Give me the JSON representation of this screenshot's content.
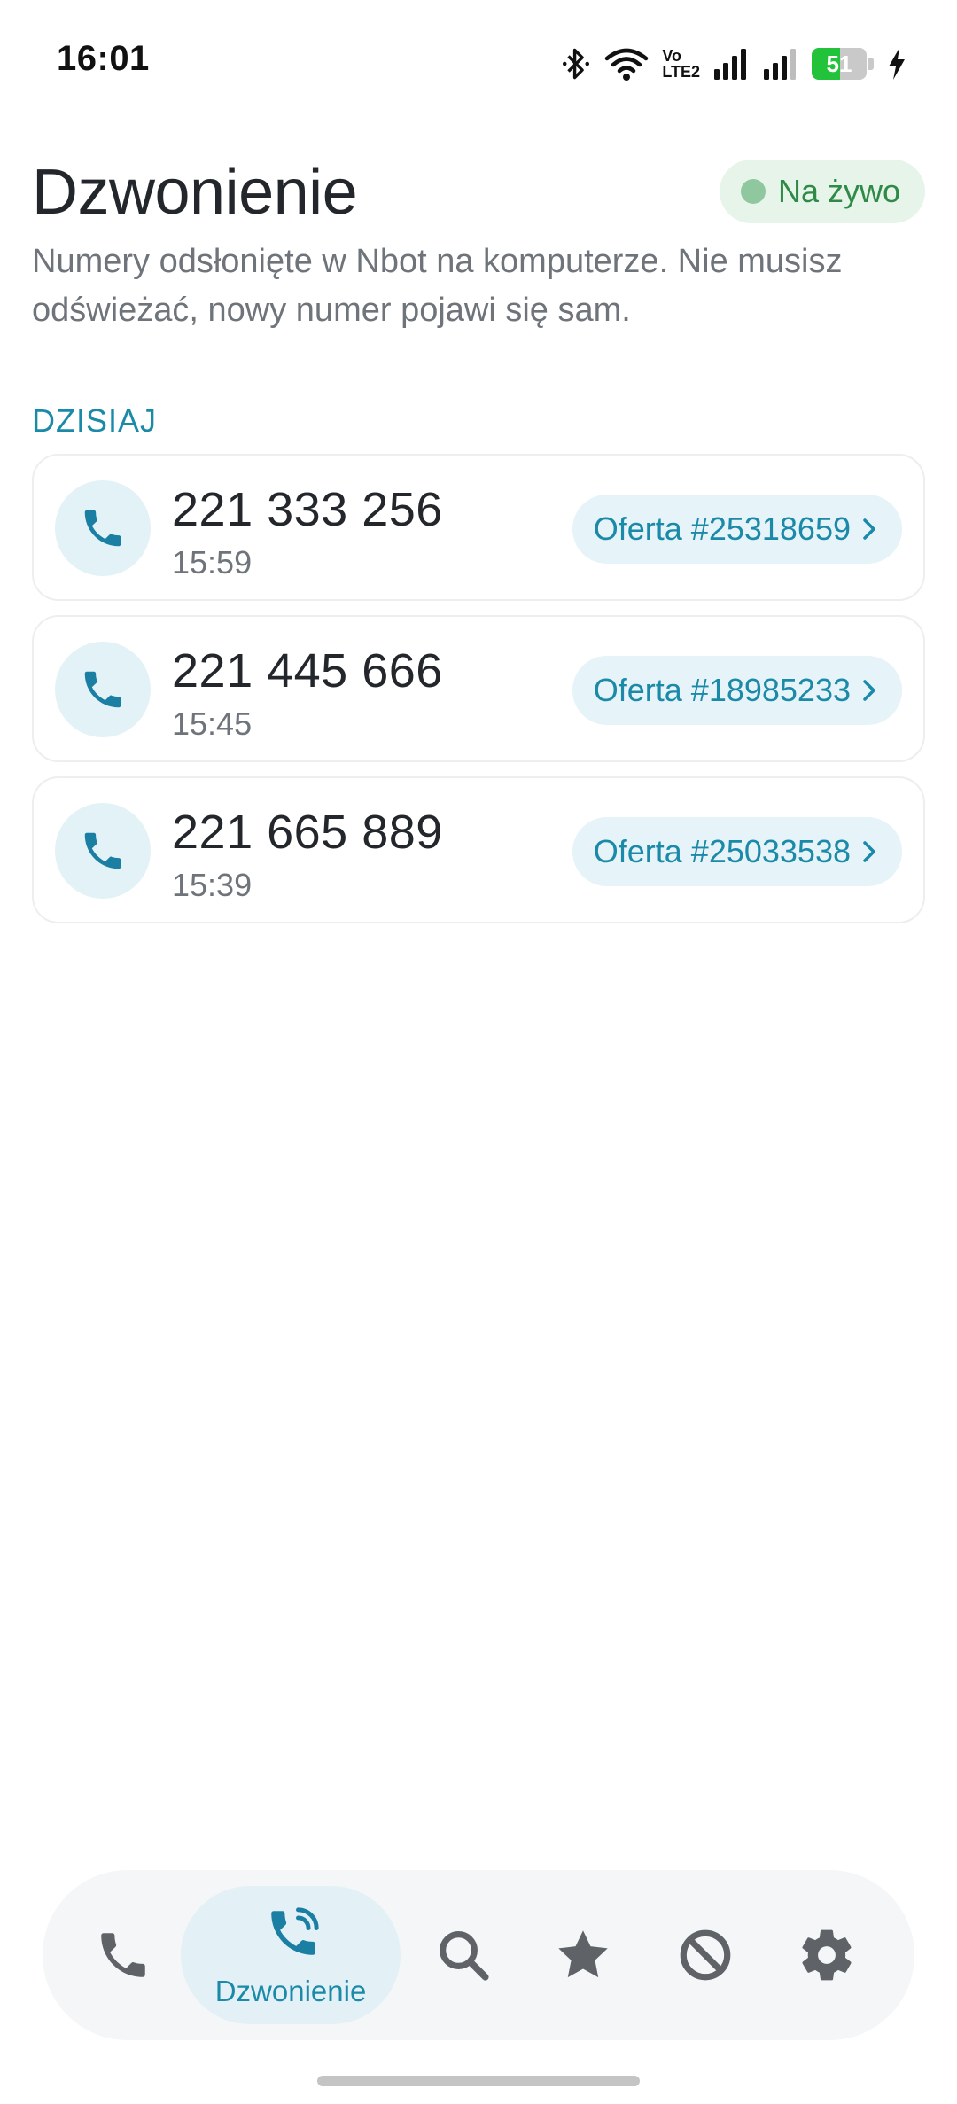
{
  "status_bar": {
    "time": "16:01",
    "battery_level": "51",
    "battery_percent": 51,
    "network_label_top": "Vo",
    "network_label_bottom": "LTE2",
    "icons": [
      "bluetooth-icon",
      "wifi-icon",
      "volte-icon",
      "signal-icon",
      "signal-icon",
      "battery-icon",
      "charging-icon"
    ]
  },
  "header": {
    "title": "Dzwonienie",
    "live_badge": "Na żywo",
    "subtitle": "Numery odsłonięte w Nbot na komputerze. Nie musisz odświeżać, nowy numer pojawi się sam."
  },
  "section": {
    "label": "DZISIAJ"
  },
  "calls": [
    {
      "number": "221 333 256",
      "time": "15:59",
      "offer": "Oferta #25318659"
    },
    {
      "number": "221 445 666",
      "time": "15:45",
      "offer": "Oferta #18985233"
    },
    {
      "number": "221 665 889",
      "time": "15:39",
      "offer": "Oferta #25033538"
    }
  ],
  "bottom_nav": {
    "items": [
      {
        "icon": "phone-icon"
      },
      {
        "icon": "phone-ringing-icon",
        "label": "Dzwonienie",
        "active": true
      },
      {
        "icon": "search-icon"
      },
      {
        "icon": "star-icon"
      },
      {
        "icon": "block-icon"
      },
      {
        "icon": "gear-icon"
      }
    ]
  },
  "colors": {
    "accent": "#1a8aa8",
    "live_green": "#2e8a46",
    "live_bg": "#e6f4ea",
    "nav_icon": "#5f6368",
    "battery_green": "#22c33a"
  }
}
